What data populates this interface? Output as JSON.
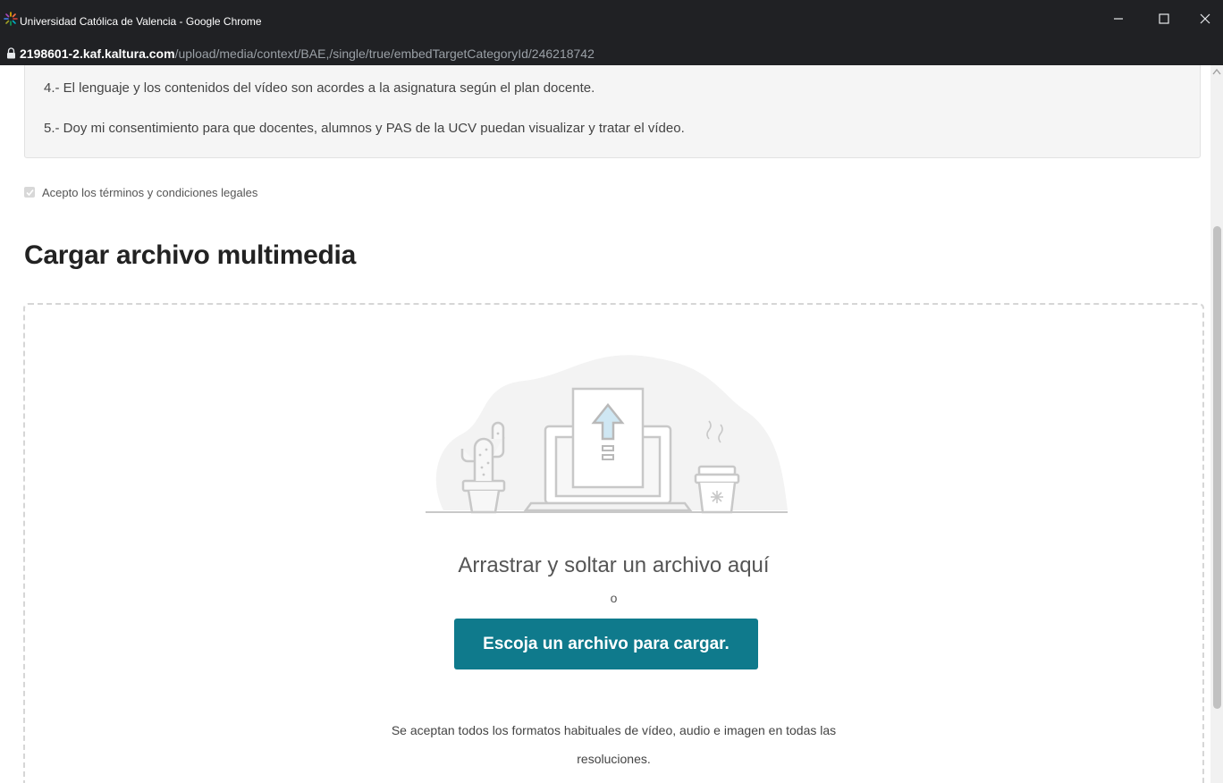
{
  "window": {
    "title": "Universidad Católica de Valencia - Google Chrome",
    "app_icon": "ucv-logo-icon",
    "controls": [
      "minimize-icon",
      "maximize-icon",
      "close-icon"
    ]
  },
  "address_bar": {
    "host": "2198601-2.kaf.kaltura.com",
    "path": "/upload/media/context/BAE,/single/true/embedTargetCategoryId/246218742",
    "lock_icon": "lock-icon"
  },
  "terms": {
    "line4": "4.- El lenguaje y los contenidos del vídeo son acordes a la asignatura según el plan docente.",
    "line5": "5.- Doy mi consentimiento para que docentes, alumnos y PAS de la UCV puedan visualizar y tratar el vídeo."
  },
  "accept": {
    "label": "Acepto los términos y condiciones legales",
    "checked": true
  },
  "upload": {
    "title": "Cargar archivo multimedia",
    "drag_text": "Arrastrar y soltar un archivo aquí",
    "or_text": "o",
    "button_label": "Escoja un archivo para cargar.",
    "formats_text": "Se aceptan todos los formatos habituales de vídeo, audio e imagen en todas las resoluciones.",
    "illustration": "upload-illustration"
  },
  "colors": {
    "accent": "#0f7a8c",
    "titlebar": "#202124"
  }
}
